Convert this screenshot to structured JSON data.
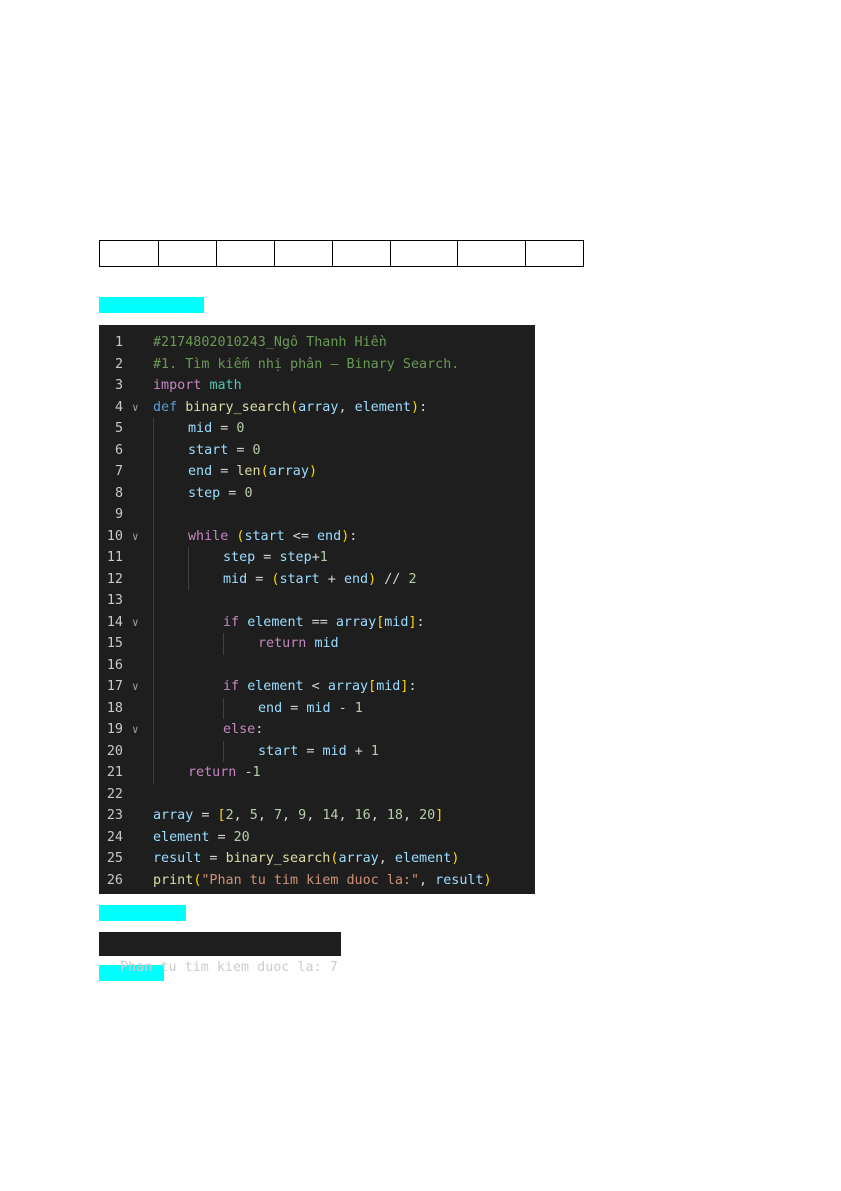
{
  "table": {
    "columns": 8,
    "cells": [
      "",
      "",
      "",
      "",
      "",
      "",
      "",
      ""
    ]
  },
  "highlights": [
    "",
    "",
    ""
  ],
  "code": {
    "theme": {
      "background": "#1e1e1e",
      "keyword": "#c586c0",
      "def": "#569cd6",
      "function": "#dcdcaa",
      "variable": "#9cdcfe",
      "number": "#b5cea8",
      "string": "#ce9178",
      "comment": "#6a9955",
      "module": "#4ec9b0"
    },
    "lines": [
      {
        "n": "1",
        "fold": false,
        "indent": 0,
        "tokens": [
          {
            "t": "#2174802010243_Ngô Thanh Hiền",
            "c": "cm"
          }
        ]
      },
      {
        "n": "2",
        "fold": false,
        "indent": 0,
        "tokens": [
          {
            "t": "#1. Tìm kiếm nhị phân – Binary Search.",
            "c": "cm"
          }
        ]
      },
      {
        "n": "3",
        "fold": false,
        "indent": 0,
        "tokens": [
          {
            "t": "import",
            "c": "kw"
          },
          {
            "t": " ",
            "c": "op"
          },
          {
            "t": "math",
            "c": "mod"
          }
        ]
      },
      {
        "n": "4",
        "fold": true,
        "indent": 0,
        "tokens": [
          {
            "t": "def",
            "c": "def"
          },
          {
            "t": " ",
            "c": "op"
          },
          {
            "t": "binary_search",
            "c": "fn"
          },
          {
            "t": "(",
            "c": "b1"
          },
          {
            "t": "array",
            "c": "var"
          },
          {
            "t": ", ",
            "c": "op"
          },
          {
            "t": "element",
            "c": "var"
          },
          {
            "t": ")",
            "c": "b1"
          },
          {
            "t": ":",
            "c": "op"
          }
        ]
      },
      {
        "n": "5",
        "fold": false,
        "indent": 1,
        "tokens": [
          {
            "t": "mid",
            "c": "var"
          },
          {
            "t": " = ",
            "c": "op"
          },
          {
            "t": "0",
            "c": "num"
          }
        ]
      },
      {
        "n": "6",
        "fold": false,
        "indent": 1,
        "tokens": [
          {
            "t": "start",
            "c": "var"
          },
          {
            "t": " = ",
            "c": "op"
          },
          {
            "t": "0",
            "c": "num"
          }
        ]
      },
      {
        "n": "7",
        "fold": false,
        "indent": 1,
        "tokens": [
          {
            "t": "end",
            "c": "var"
          },
          {
            "t": " = ",
            "c": "op"
          },
          {
            "t": "len",
            "c": "fn"
          },
          {
            "t": "(",
            "c": "b1"
          },
          {
            "t": "array",
            "c": "var"
          },
          {
            "t": ")",
            "c": "b1"
          }
        ]
      },
      {
        "n": "8",
        "fold": false,
        "indent": 1,
        "tokens": [
          {
            "t": "step",
            "c": "var"
          },
          {
            "t": " = ",
            "c": "op"
          },
          {
            "t": "0",
            "c": "num"
          }
        ]
      },
      {
        "n": "9",
        "fold": false,
        "indent": 1,
        "tokens": []
      },
      {
        "n": "10",
        "fold": true,
        "indent": 1,
        "tokens": [
          {
            "t": "while",
            "c": "kw"
          },
          {
            "t": " ",
            "c": "op"
          },
          {
            "t": "(",
            "c": "b1"
          },
          {
            "t": "start",
            "c": "var"
          },
          {
            "t": " <= ",
            "c": "op"
          },
          {
            "t": "end",
            "c": "var"
          },
          {
            "t": ")",
            "c": "b1"
          },
          {
            "t": ":",
            "c": "op"
          }
        ]
      },
      {
        "n": "11",
        "fold": false,
        "indent": 2,
        "tokens": [
          {
            "t": "step",
            "c": "var"
          },
          {
            "t": " = ",
            "c": "op"
          },
          {
            "t": "step",
            "c": "var"
          },
          {
            "t": "+",
            "c": "op"
          },
          {
            "t": "1",
            "c": "num"
          }
        ]
      },
      {
        "n": "12",
        "fold": false,
        "indent": 2,
        "tokens": [
          {
            "t": "mid",
            "c": "var"
          },
          {
            "t": " = ",
            "c": "op"
          },
          {
            "t": "(",
            "c": "b1"
          },
          {
            "t": "start",
            "c": "var"
          },
          {
            "t": " + ",
            "c": "op"
          },
          {
            "t": "end",
            "c": "var"
          },
          {
            "t": ")",
            "c": "b1"
          },
          {
            "t": " // ",
            "c": "op"
          },
          {
            "t": "2",
            "c": "num"
          }
        ]
      },
      {
        "n": "13",
        "fold": false,
        "indent": 2,
        "tokens": []
      },
      {
        "n": "14",
        "fold": true,
        "indent": 2,
        "tokens": [
          {
            "t": "if",
            "c": "kw"
          },
          {
            "t": " ",
            "c": "op"
          },
          {
            "t": "element",
            "c": "var"
          },
          {
            "t": " == ",
            "c": "op"
          },
          {
            "t": "array",
            "c": "var"
          },
          {
            "t": "[",
            "c": "b1"
          },
          {
            "t": "mid",
            "c": "var"
          },
          {
            "t": "]",
            "c": "b1"
          },
          {
            "t": ":",
            "c": "op"
          }
        ]
      },
      {
        "n": "15",
        "fold": false,
        "indent": 3,
        "tokens": [
          {
            "t": "return",
            "c": "kw"
          },
          {
            "t": " ",
            "c": "op"
          },
          {
            "t": "mid",
            "c": "var"
          }
        ]
      },
      {
        "n": "16",
        "fold": false,
        "indent": 2,
        "tokens": []
      },
      {
        "n": "17",
        "fold": true,
        "indent": 2,
        "tokens": [
          {
            "t": "if",
            "c": "kw"
          },
          {
            "t": " ",
            "c": "op"
          },
          {
            "t": "element",
            "c": "var"
          },
          {
            "t": " < ",
            "c": "op"
          },
          {
            "t": "array",
            "c": "var"
          },
          {
            "t": "[",
            "c": "b1"
          },
          {
            "t": "mid",
            "c": "var"
          },
          {
            "t": "]",
            "c": "b1"
          },
          {
            "t": ":",
            "c": "op"
          }
        ]
      },
      {
        "n": "18",
        "fold": false,
        "indent": 3,
        "tokens": [
          {
            "t": "end",
            "c": "var"
          },
          {
            "t": " = ",
            "c": "op"
          },
          {
            "t": "mid",
            "c": "var"
          },
          {
            "t": " - ",
            "c": "op"
          },
          {
            "t": "1",
            "c": "num"
          }
        ]
      },
      {
        "n": "19",
        "fold": true,
        "indent": 2,
        "tokens": [
          {
            "t": "else",
            "c": "kw"
          },
          {
            "t": ":",
            "c": "op"
          }
        ]
      },
      {
        "n": "20",
        "fold": false,
        "indent": 3,
        "tokens": [
          {
            "t": "start",
            "c": "var"
          },
          {
            "t": " = ",
            "c": "op"
          },
          {
            "t": "mid",
            "c": "var"
          },
          {
            "t": " + ",
            "c": "op"
          },
          {
            "t": "1",
            "c": "num"
          }
        ]
      },
      {
        "n": "21",
        "fold": false,
        "indent": 1,
        "tokens": [
          {
            "t": "return",
            "c": "kw"
          },
          {
            "t": " ",
            "c": "op"
          },
          {
            "t": "-",
            "c": "op"
          },
          {
            "t": "1",
            "c": "num"
          }
        ]
      },
      {
        "n": "22",
        "fold": false,
        "indent": 0,
        "tokens": []
      },
      {
        "n": "23",
        "fold": false,
        "indent": 0,
        "tokens": [
          {
            "t": "array",
            "c": "var"
          },
          {
            "t": " = ",
            "c": "op"
          },
          {
            "t": "[",
            "c": "b1"
          },
          {
            "t": "2",
            "c": "num"
          },
          {
            "t": ", ",
            "c": "op"
          },
          {
            "t": "5",
            "c": "num"
          },
          {
            "t": ", ",
            "c": "op"
          },
          {
            "t": "7",
            "c": "num"
          },
          {
            "t": ", ",
            "c": "op"
          },
          {
            "t": "9",
            "c": "num"
          },
          {
            "t": ", ",
            "c": "op"
          },
          {
            "t": "14",
            "c": "num"
          },
          {
            "t": ", ",
            "c": "op"
          },
          {
            "t": "16",
            "c": "num"
          },
          {
            "t": ", ",
            "c": "op"
          },
          {
            "t": "18",
            "c": "num"
          },
          {
            "t": ", ",
            "c": "op"
          },
          {
            "t": "20",
            "c": "num"
          },
          {
            "t": "]",
            "c": "b1"
          }
        ]
      },
      {
        "n": "24",
        "fold": false,
        "indent": 0,
        "tokens": [
          {
            "t": "element",
            "c": "var"
          },
          {
            "t": " = ",
            "c": "op"
          },
          {
            "t": "20",
            "c": "num"
          }
        ]
      },
      {
        "n": "25",
        "fold": false,
        "indent": 0,
        "tokens": [
          {
            "t": "result",
            "c": "var"
          },
          {
            "t": " = ",
            "c": "op"
          },
          {
            "t": "binary_search",
            "c": "fn"
          },
          {
            "t": "(",
            "c": "b1"
          },
          {
            "t": "array",
            "c": "var"
          },
          {
            "t": ", ",
            "c": "op"
          },
          {
            "t": "element",
            "c": "var"
          },
          {
            "t": ")",
            "c": "b1"
          }
        ]
      },
      {
        "n": "26",
        "fold": false,
        "indent": 0,
        "tokens": [
          {
            "t": "print",
            "c": "fn"
          },
          {
            "t": "(",
            "c": "b1"
          },
          {
            "t": "\"Phan tu tim kiem duoc la:\"",
            "c": "str"
          },
          {
            "t": ", ",
            "c": "op"
          },
          {
            "t": "result",
            "c": "var"
          },
          {
            "t": ")",
            "c": "b1"
          }
        ]
      }
    ]
  },
  "output": {
    "text": "Phan tu tim kiem duoc la: 7"
  }
}
